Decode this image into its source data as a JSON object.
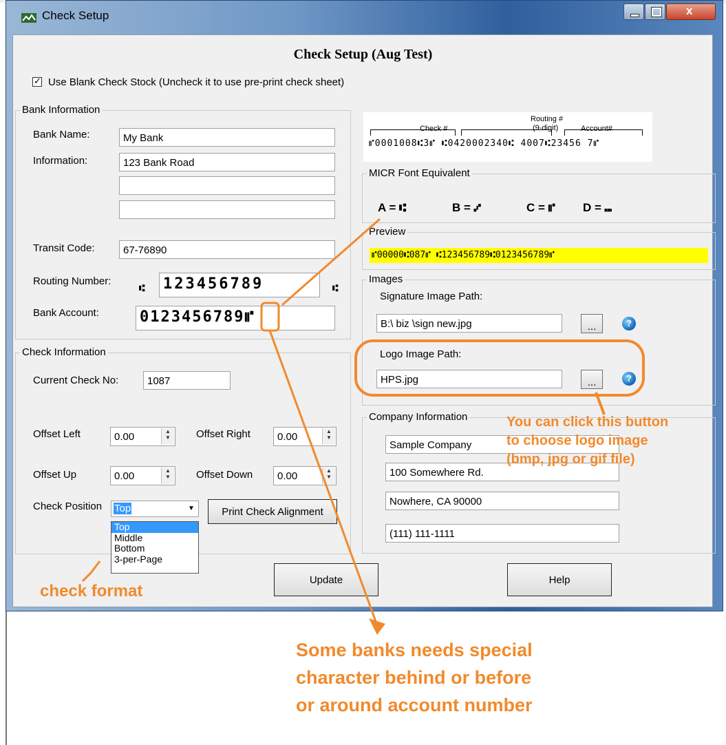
{
  "window": {
    "title": "Check Setup",
    "heading": "Check Setup (Aug Test)"
  },
  "blank_stock": {
    "checked": true,
    "label": "Use Blank Check Stock (Uncheck it to use pre-print check sheet)"
  },
  "bank": {
    "group_title": "Bank Information",
    "name_label": "Bank Name:",
    "name_value": "My Bank",
    "info_label": "Information:",
    "info_lines": [
      "123 Bank Road",
      "",
      ""
    ],
    "transit_label": "Transit Code:",
    "transit_value": "67-76890",
    "routing_label": "Routing Number:",
    "routing_value": "123456789",
    "routing_symbol": "⑆",
    "account_label": "Bank Account:",
    "account_value": "0123456789⑈"
  },
  "check_info": {
    "group_title": "Check Information",
    "current_label": "Current Check No:",
    "current_value": "1087",
    "offset_left_label": "Offset Left",
    "offset_left_value": "0.00",
    "offset_right_label": "Offset Right",
    "offset_right_value": "0.00",
    "offset_up_label": "Offset Up",
    "offset_up_value": "0.00",
    "offset_down_label": "Offset Down",
    "offset_down_value": "0.00",
    "position_label": "Check Position",
    "position_value": "Top",
    "position_options": [
      "Top",
      "Middle",
      "Bottom",
      "3-per-Page"
    ],
    "print_alignment_label": "Print Check Alignment"
  },
  "micr_example": {
    "check_label": "Check #",
    "routing_label": "Routing #",
    "routing_sub": "(9-digit)",
    "account_label": "Account#",
    "line": "⑈0001008⑆3⑈ ⑆0420002340⑆ 4007⑆23456 7⑈"
  },
  "micr_font": {
    "group_title": "MICR Font Equivalent",
    "items": [
      {
        "key": "A =",
        "symbol": "⑆"
      },
      {
        "key": "B =",
        "symbol": "⑇"
      },
      {
        "key": "C =",
        "symbol": "⑈"
      },
      {
        "key": "D =",
        "symbol": "⑉"
      }
    ]
  },
  "preview": {
    "group_title": "Preview",
    "line": "⑈00000⑆087⑈ ⑆123456789⑆0123456789⑈",
    "highlight_color": "#ffff00"
  },
  "images": {
    "group_title": "Images",
    "signature_label": "Signature Image Path:",
    "signature_value": "B:\\  biz \\sign new.jpg",
    "logo_label": "Logo Image Path:",
    "logo_value": "HPS.jpg",
    "browse_label": "...",
    "help_icon": "question-icon"
  },
  "company": {
    "group_title": "Company Information",
    "lines": [
      "Sample Company",
      "100 Somewhere Rd.",
      "Nowhere, CA 90000",
      "(111) 111-1111"
    ]
  },
  "buttons": {
    "update": "Update",
    "help": "Help"
  },
  "annotations": {
    "color": "#f18a2c",
    "logo_note": [
      "You can click this button",
      "to choose logo image",
      "(bmp, jpg or gif file)"
    ],
    "format_note": "check format",
    "bank_note": [
      "Some banks needs special",
      "character behind or before",
      "or around account number"
    ]
  }
}
